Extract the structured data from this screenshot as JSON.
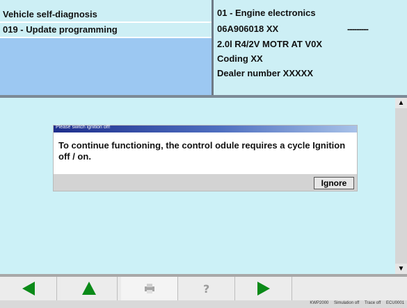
{
  "header": {
    "left": {
      "title": "Vehicle self-diagnosis",
      "subtitle": "019 - Update programming"
    },
    "right": {
      "module": "01 - Engine electronics",
      "part_number": "06A906018 XX",
      "part_number_dashes": "---------",
      "engine": "2.0l R4/2V  MOTR AT V0X",
      "coding": "Coding  XX",
      "dealer": "Dealer number  XXXXX"
    }
  },
  "dialog": {
    "title": "Please switch ignition off!",
    "message": "To continue functioning, the control odule requires a cycle Ignition off / on.",
    "ignore_label": "Ignore"
  },
  "toolbar": {
    "buttons": [
      {
        "icon": "arrow-left-icon",
        "color": "#0a8a18"
      },
      {
        "icon": "arrow-up-icon",
        "color": "#0a8a18"
      },
      {
        "icon": "printer-icon",
        "color": "#9a9a9a"
      },
      {
        "icon": "help-icon",
        "color": "#9a9a9a"
      },
      {
        "icon": "arrow-right-icon",
        "color": "#0a8a18"
      }
    ]
  },
  "statusbar": {
    "item1": "KWP2000",
    "item2": "Simulation off",
    "item3": "Trace off",
    "item4": "ECU0001"
  },
  "colors": {
    "accent_green": "#0a8a18",
    "panel_blue": "#9cc8f2",
    "content_bg": "#ccf1f7"
  }
}
